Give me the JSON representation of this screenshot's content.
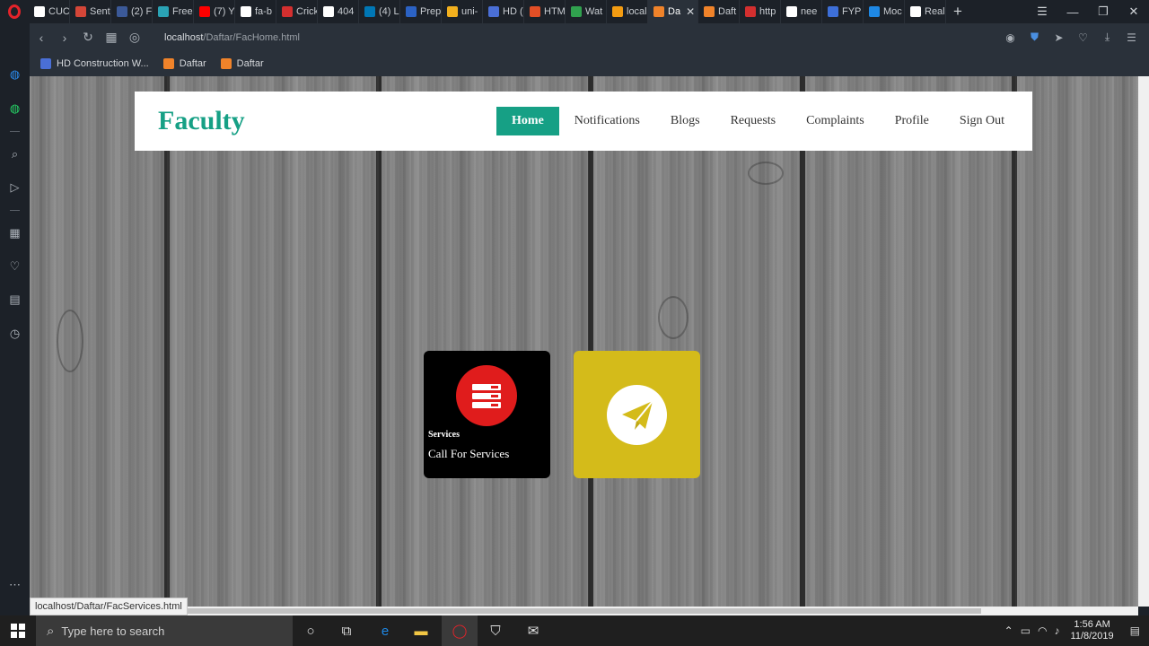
{
  "browser": {
    "tabs": [
      {
        "label": "CUC",
        "color": "#ffffff"
      },
      {
        "label": "Sent",
        "color": "#d44638"
      },
      {
        "label": "(2) F",
        "color": "#3b5998"
      },
      {
        "label": "Free",
        "color": "#2aa3b5"
      },
      {
        "label": "(7) Y",
        "color": "#ff0000"
      },
      {
        "label": "fa-b",
        "color": "#ffffff"
      },
      {
        "label": "Crick",
        "color": "#d32f2f"
      },
      {
        "label": "404",
        "color": "#ffffff"
      },
      {
        "label": "(4) L",
        "color": "#0077b5"
      },
      {
        "label": "Prep",
        "color": "#2b62c4"
      },
      {
        "label": "uni-",
        "color": "#f2b01e"
      },
      {
        "label": "HD (",
        "color": "#4a6fd6"
      },
      {
        "label": "HTM",
        "color": "#e34f26"
      },
      {
        "label": "Wat",
        "color": "#30a14e"
      },
      {
        "label": "local",
        "color": "#f39c12"
      },
      {
        "label": "Da",
        "color": "#f0832a",
        "active": true
      },
      {
        "label": "Daft",
        "color": "#f0832a"
      },
      {
        "label": "http",
        "color": "#d32f2f"
      },
      {
        "label": "nee",
        "color": "#ffffff"
      },
      {
        "label": "FYP",
        "color": "#3d6fd8"
      },
      {
        "label": "Moc",
        "color": "#1e88e5"
      },
      {
        "label": "Real",
        "color": "#ffffff"
      }
    ],
    "address": {
      "host": "localhost",
      "path": "/Daftar/FacHome.html"
    },
    "bookmarks": [
      {
        "label": "HD Construction W...",
        "color": "#4a6fd6"
      },
      {
        "label": "Daftar",
        "color": "#f0832a"
      },
      {
        "label": "Daftar",
        "color": "#f0832a"
      }
    ],
    "status_url": "localhost/Daftar/FacServices.html"
  },
  "page": {
    "brand": "Faculty",
    "nav": [
      {
        "label": "Home",
        "active": true
      },
      {
        "label": "Notifications"
      },
      {
        "label": "Blogs"
      },
      {
        "label": "Requests"
      },
      {
        "label": "Complaints"
      },
      {
        "label": "Profile"
      },
      {
        "label": "Sign Out"
      }
    ],
    "cards": [
      {
        "tag": "Services",
        "title": "Call For Services",
        "icon": "server-icon",
        "bg": "#000000",
        "circle": "#e01c1c"
      },
      {
        "icon": "paper-plane-icon",
        "bg": "#d4bb1a",
        "circle": "#ffffff"
      }
    ],
    "accent": "#16a085"
  },
  "taskbar": {
    "search_placeholder": "Type here to search",
    "time": "1:56 AM",
    "date": "11/8/2019"
  }
}
